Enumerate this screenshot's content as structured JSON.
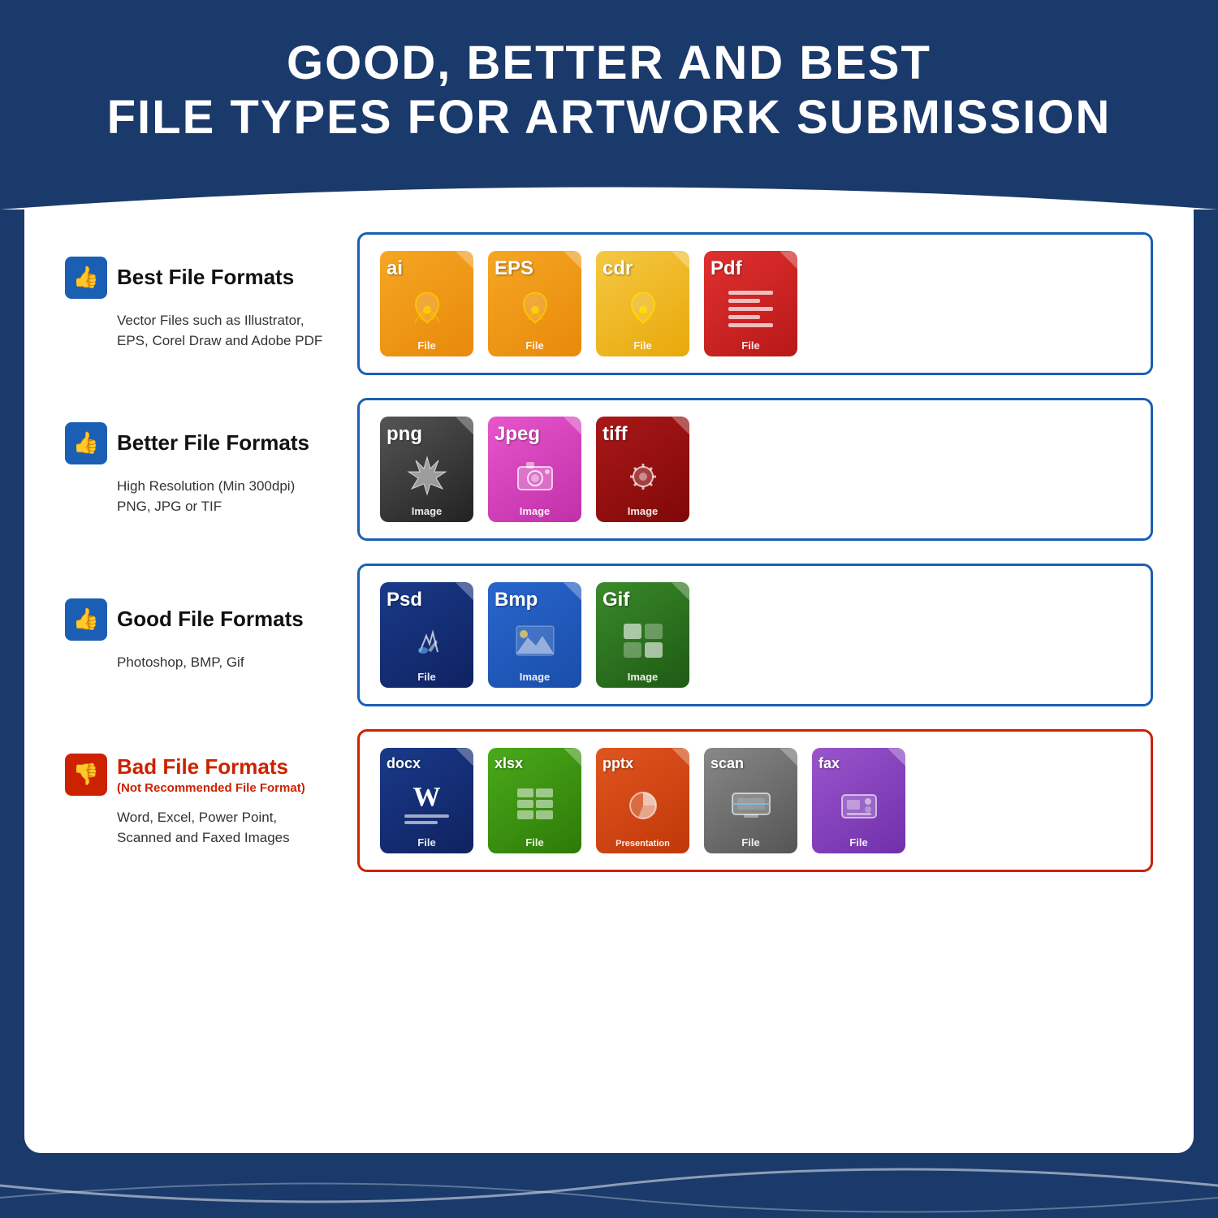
{
  "header": {
    "line1": "GOOD, BETTER AND BEST",
    "line2": "FILE TYPES FOR ARTWORK SUBMISSION"
  },
  "rows": [
    {
      "id": "best",
      "thumbs": "up",
      "title": "Best File Formats",
      "subtitle": null,
      "description": "Vector Files such as Illustrator,\nEPS, Corel Draw and Adobe PDF",
      "borderColor": "blue",
      "files": [
        {
          "ext": "ai",
          "color": "orange",
          "label": "File",
          "iconType": "vector"
        },
        {
          "ext": "EPS",
          "color": "orange",
          "label": "File",
          "iconType": "vector"
        },
        {
          "ext": "cdr",
          "color": "amber",
          "label": "File",
          "iconType": "vector"
        },
        {
          "ext": "Pdf",
          "color": "red",
          "label": "File",
          "iconType": "pdf"
        }
      ]
    },
    {
      "id": "better",
      "thumbs": "up",
      "title": "Better File Formats",
      "subtitle": null,
      "description": "High Resolution (Min 300dpi)\nPNG, JPG or TIF",
      "borderColor": "blue",
      "files": [
        {
          "ext": "png",
          "color": "darkgray",
          "label": "Image",
          "iconType": "starburst"
        },
        {
          "ext": "Jpeg",
          "color": "pink",
          "label": "Image",
          "iconType": "camera"
        },
        {
          "ext": "tiff",
          "color": "darkred",
          "label": "Image",
          "iconType": "gear"
        }
      ]
    },
    {
      "id": "good",
      "thumbs": "up",
      "title": "Good File Formats",
      "subtitle": null,
      "description": "Photoshop, BMP, Gif",
      "borderColor": "blue",
      "files": [
        {
          "ext": "Psd",
          "color": "navy",
          "label": "File",
          "iconType": "paint"
        },
        {
          "ext": "Bmp",
          "color": "blue",
          "label": "Image",
          "iconType": "mountain"
        },
        {
          "ext": "Gif",
          "color": "green",
          "label": "Image",
          "iconType": "grid"
        }
      ]
    },
    {
      "id": "bad",
      "thumbs": "down",
      "title": "Bad File Formats",
      "subtitle": "(Not Recommended File Format)",
      "description": "Word, Excel, Power Point,\nScanned and Faxed Images",
      "borderColor": "red",
      "files": [
        {
          "ext": "docx",
          "color": "darkblue",
          "label": "File",
          "iconType": "word"
        },
        {
          "ext": "xlsx",
          "color": "green",
          "label": "File",
          "iconType": "excel"
        },
        {
          "ext": "pptx",
          "color": "orange-red",
          "label": "Presentation",
          "iconType": "ppt"
        },
        {
          "ext": "scan",
          "color": "gray",
          "label": "File",
          "iconType": "scan"
        },
        {
          "ext": "fax",
          "color": "purple",
          "label": "File",
          "iconType": "fax"
        }
      ]
    }
  ]
}
